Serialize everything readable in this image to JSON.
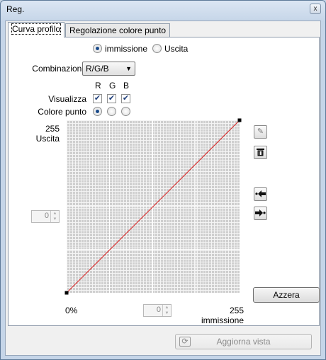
{
  "window": {
    "title": "Reg.",
    "close_glyph": "x"
  },
  "tabs": [
    {
      "label": "Curva profilo",
      "active": true
    },
    {
      "label": "Regolazione colore punto",
      "active": false
    }
  ],
  "mode": {
    "options": [
      "immissione",
      "Uscita"
    ],
    "selected": "immissione"
  },
  "combinazione": {
    "label": "Combinazione",
    "value": "R/G/B"
  },
  "channels": {
    "headers": [
      "R",
      "G",
      "B"
    ],
    "visualizza_label": "Visualizza",
    "visualizza": [
      true,
      true,
      true
    ]
  },
  "colore_punto": {
    "label": "Colore punto",
    "selected_index": 0
  },
  "graph": {
    "y_top_label": "255",
    "y_axis_label": "Uscita",
    "x_left_label": "0%",
    "x_right_label": "255",
    "x_axis_label": "immissione",
    "curve_color": "#d81e1e",
    "points": [
      [
        0,
        0
      ],
      [
        255,
        255
      ]
    ]
  },
  "spinners": {
    "left_value": "0",
    "bottom_value": "0"
  },
  "tools": [
    "eyedropper-icon",
    "trash-icon",
    "import-point-icon",
    "export-point-icon"
  ],
  "buttons": {
    "reset": "Azzera",
    "refresh": "Aggiorna vista"
  }
}
